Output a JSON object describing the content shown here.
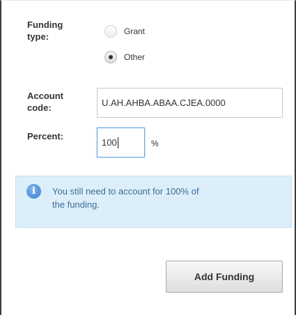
{
  "funding_type": {
    "label": "Funding type:",
    "label_line1": "Funding",
    "label_line2": "type:",
    "options": [
      {
        "label": "Grant",
        "checked": false
      },
      {
        "label": "Other",
        "checked": true
      }
    ]
  },
  "account_code": {
    "label_line1": "Account",
    "label_line2": "code:",
    "value": "U.AH.AHBA.ABAA.CJEA.0000"
  },
  "percent": {
    "label": "Percent:",
    "value": "100",
    "unit": "%"
  },
  "info": {
    "icon": "info-icon",
    "message_line1": "You still need to account for 100% of",
    "message_line2": "the funding."
  },
  "actions": {
    "add_funding_label": "Add Funding"
  },
  "colors": {
    "info_background": "#dceefa",
    "info_text": "#3b6d96",
    "focus_border": "#66a3e0"
  }
}
